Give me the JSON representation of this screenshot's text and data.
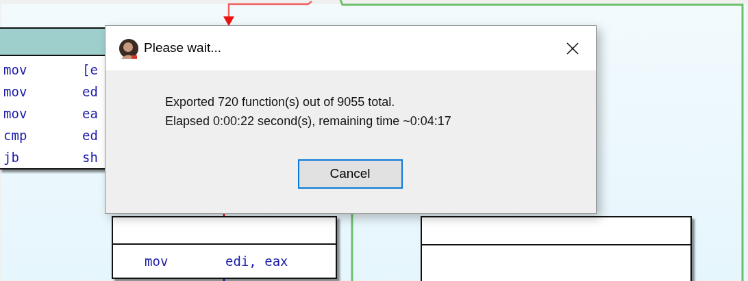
{
  "graph": {
    "nodes": [
      {
        "selected": true,
        "instructions": [
          {
            "mnemonic": "mov",
            "operand": "[e"
          },
          {
            "mnemonic": "mov",
            "operand": "ed"
          },
          {
            "mnemonic": "mov",
            "operand": "ea"
          },
          {
            "mnemonic": "cmp",
            "operand": "ed"
          },
          {
            "mnemonic": "jb",
            "operand": "sh"
          }
        ]
      },
      {
        "selected": false,
        "instructions": [
          {
            "mnemonic": "mov",
            "operand": "edi, eax"
          }
        ]
      },
      {
        "selected": false
      }
    ]
  },
  "dialog": {
    "title": "Please wait...",
    "message_lines": [
      "Exported 720 function(s) out of 9055 total.",
      "Elapsed 0:00:22 second(s), remaining time ~0:04:17"
    ],
    "buttons": [
      {
        "label": "Cancel",
        "focused": true
      }
    ]
  }
}
